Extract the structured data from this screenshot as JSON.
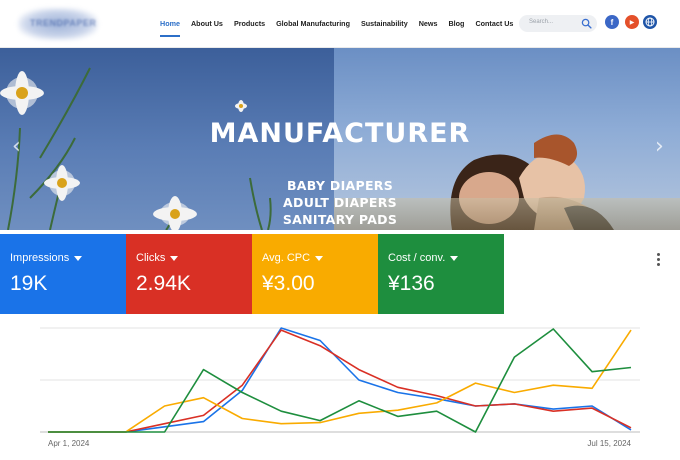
{
  "header": {
    "logo_text": "TRENDPAPER",
    "nav": [
      "Home",
      "About Us",
      "Products",
      "Global Manufacturing",
      "Sustainability",
      "News",
      "Blog",
      "Contact Us"
    ],
    "active_nav": "Home",
    "search_placeholder": "Search...",
    "social": [
      {
        "name": "facebook-icon",
        "glyph": "f"
      },
      {
        "name": "youtube-icon",
        "glyph": "▶"
      },
      {
        "name": "globe-icon",
        "glyph": "◍"
      }
    ]
  },
  "hero": {
    "title": "MANUFACTURER",
    "lines": [
      "BABY DIAPERS",
      "ADULT DIAPERS",
      "SANITARY PADS"
    ]
  },
  "metrics": [
    {
      "label": "Impressions",
      "value": "19K",
      "color": "#1a73e8"
    },
    {
      "label": "Clicks",
      "value": "2.94K",
      "color": "#d93025"
    },
    {
      "label": "Avg. CPC",
      "value": "¥3.00",
      "color": "#f9ab00"
    },
    {
      "label": "Cost / conv.",
      "value": "¥136",
      "color": "#1e8e3e"
    }
  ],
  "chart_data": {
    "type": "line",
    "x": [
      "Apr 1, 2024",
      "",
      "",
      "",
      "",
      "",
      "",
      "",
      "",
      "",
      "",
      "",
      "",
      "",
      "",
      "Jul 15, 2024"
    ],
    "x_tick_labels": {
      "first": "Apr 1, 2024",
      "last": "Jul 15, 2024"
    },
    "ylim": [
      0,
      100
    ],
    "grid": true,
    "series": [
      {
        "color": "#1a73e8",
        "values": [
          0,
          0,
          0,
          5,
          10,
          40,
          100,
          88,
          50,
          38,
          32,
          25,
          27,
          22,
          25,
          2
        ]
      },
      {
        "color": "#d93025",
        "values": [
          0,
          0,
          0,
          8,
          16,
          45,
          98,
          83,
          60,
          43,
          35,
          25,
          27,
          20,
          23,
          4
        ]
      },
      {
        "color": "#f9ab00",
        "values": [
          0,
          0,
          0,
          25,
          33,
          13,
          8,
          9,
          18,
          21,
          28,
          47,
          38,
          45,
          42,
          98
        ]
      },
      {
        "color": "#1e8e3e",
        "values": [
          0,
          0,
          0,
          0,
          60,
          38,
          20,
          11,
          30,
          15,
          20,
          0,
          72,
          99,
          58,
          62
        ]
      }
    ]
  }
}
